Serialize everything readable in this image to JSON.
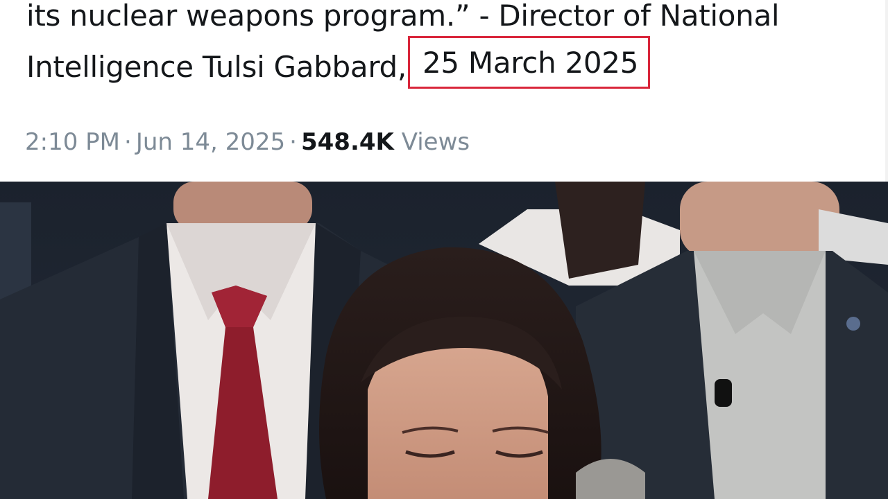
{
  "tweet": {
    "text_line_1": "its nuclear weapons program.” - Director of National",
    "text_line_2_prefix": "Intelligence Tulsi Gabbard,",
    "highlighted_date": "25 March 2025",
    "time": "2:10 PM",
    "date": "Jun 14, 2025",
    "view_count": "548.4K",
    "views_label": "Views",
    "separator": "·"
  },
  "colors": {
    "highlight_border": "#d9263b",
    "text": "#14171a",
    "meta_text": "#7d8a96"
  },
  "video": {
    "description_icon": "video-still"
  }
}
